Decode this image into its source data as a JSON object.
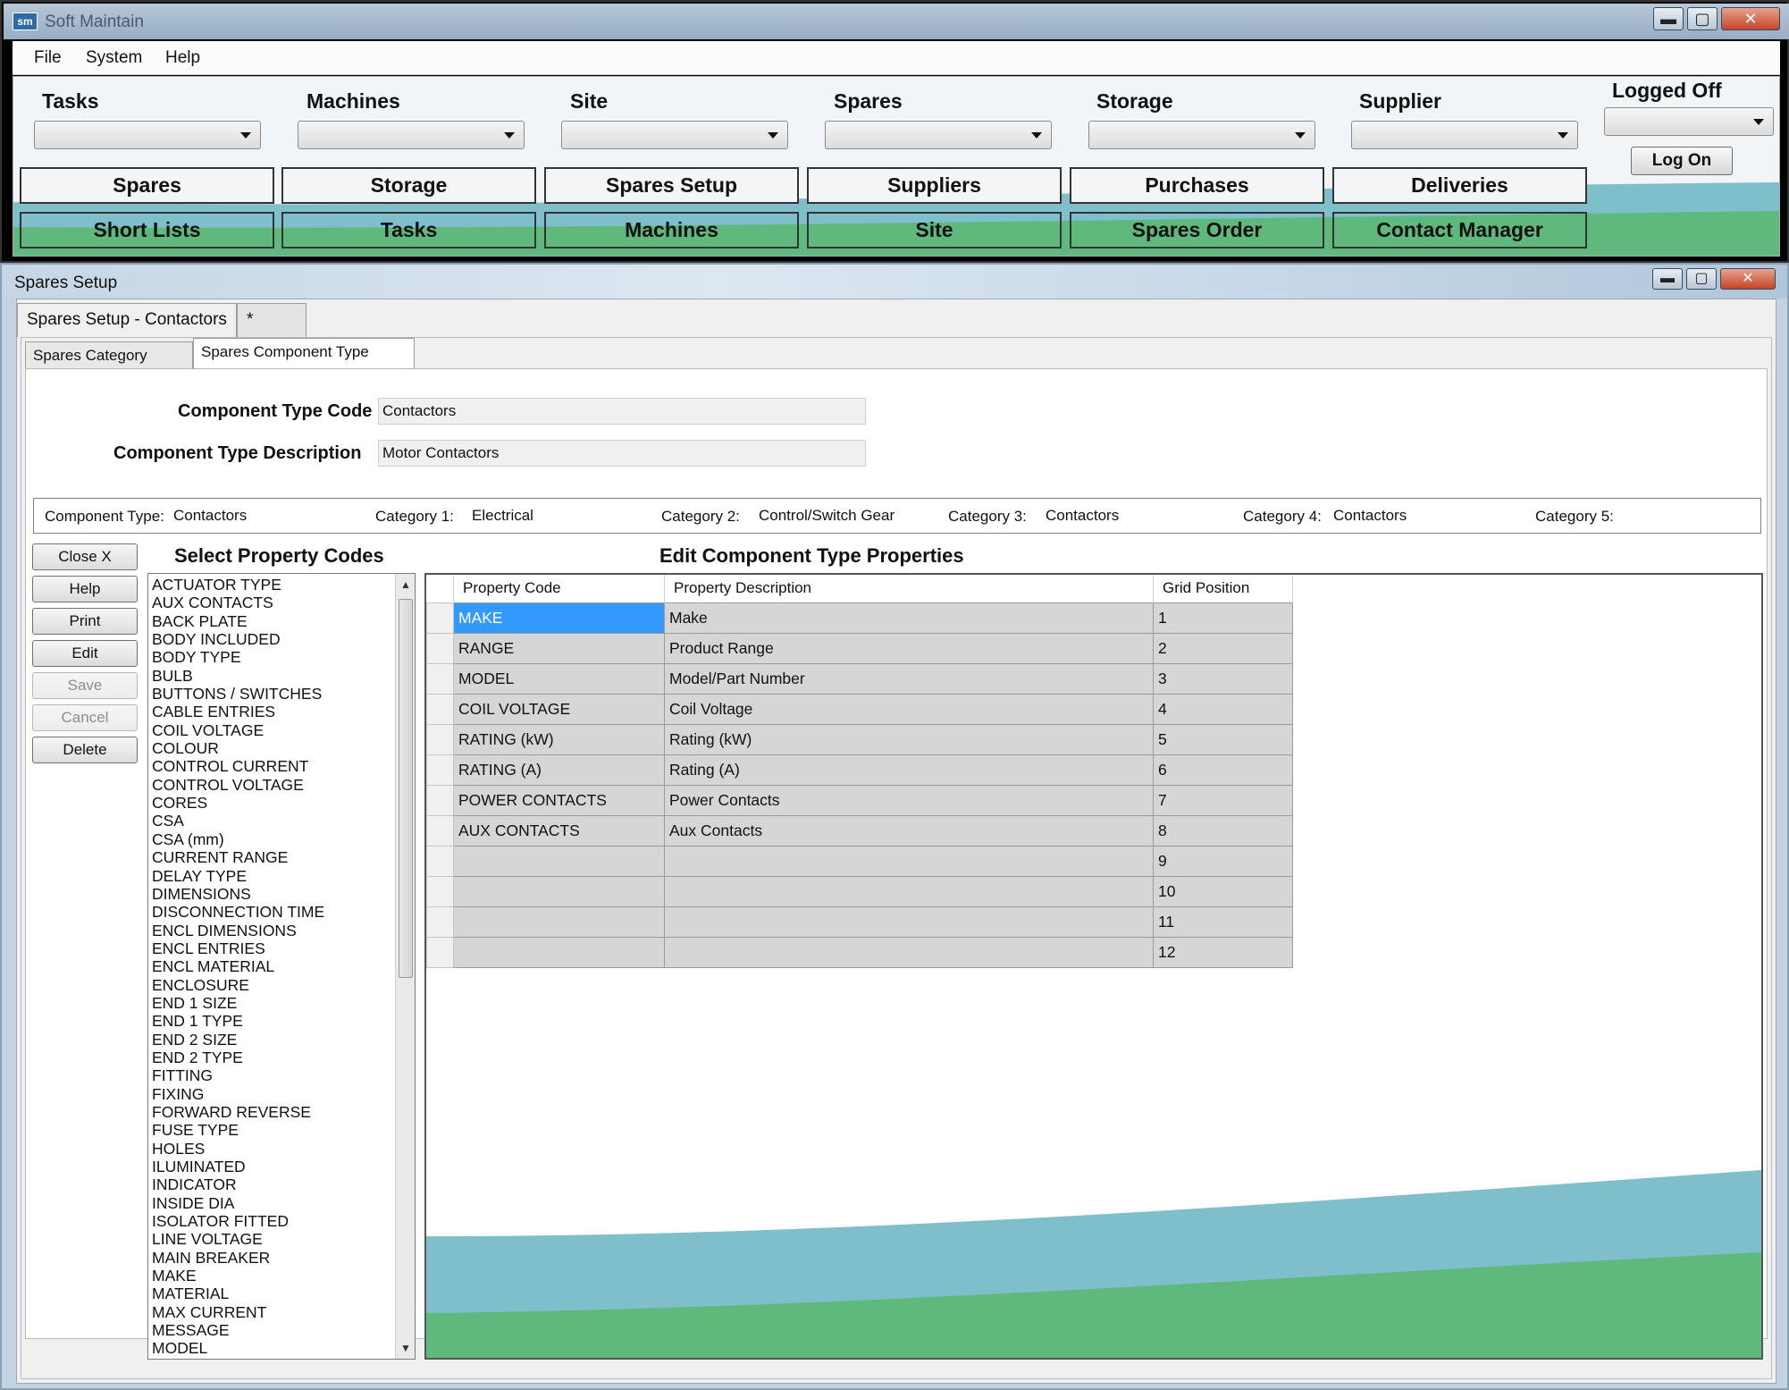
{
  "app": {
    "title": "Soft Maintain",
    "icon_text": "sm"
  },
  "window_controls": {
    "minimize": "▬",
    "maximize": "▢",
    "close": "✕"
  },
  "menu": [
    "File",
    "System",
    "Help"
  ],
  "toolbar": {
    "combos": [
      {
        "label": "Tasks",
        "value": ""
      },
      {
        "label": "Machines",
        "value": ""
      },
      {
        "label": "Site",
        "value": ""
      },
      {
        "label": "Spares",
        "value": ""
      },
      {
        "label": "Storage",
        "value": ""
      },
      {
        "label": "Supplier",
        "value": ""
      }
    ],
    "login_status": "Logged Off",
    "login_combo_value": "",
    "log_on_label": "Log On",
    "row1_buttons": [
      "Spares",
      "Storage",
      "Spares Setup",
      "Suppliers",
      "Purchases",
      "Deliveries"
    ],
    "row2_buttons": [
      "Short Lists",
      "Tasks",
      "Machines",
      "Site",
      "Spares Order",
      "Contact Manager"
    ],
    "colors": {
      "wave_blue": "#7fbfcb",
      "wave_green": "#5fb87c"
    }
  },
  "child": {
    "title": "Spares Setup",
    "doc_tabs": [
      "Spares Setup - Contactors",
      "*"
    ],
    "sub_tabs": [
      "Spares Category Setup",
      "Spares Component Type Setup"
    ],
    "active_sub_tab": 1,
    "fields": {
      "code_label": "Component Type Code",
      "code_value": "Contactors",
      "desc_label": "Component Type Description",
      "desc_value": "Motor Contactors"
    },
    "category_bar": {
      "type_label": "Component Type:",
      "type_value": "Contactors",
      "cat1_label": "Category 1:",
      "cat1_value": "Electrical",
      "cat2_label": "Category 2:",
      "cat2_value": "Control/Switch Gear",
      "cat3_label": "Category 3:",
      "cat3_value": "Contactors",
      "cat4_label": "Category 4:",
      "cat4_value": "Contactors",
      "cat5_label": "Category 5:",
      "cat5_value": ""
    },
    "side_buttons": [
      {
        "label": "Close X",
        "enabled": true
      },
      {
        "label": "Help",
        "enabled": true
      },
      {
        "label": "Print",
        "enabled": true
      },
      {
        "label": "Edit",
        "enabled": true
      },
      {
        "label": "Save",
        "enabled": false
      },
      {
        "label": "Cancel",
        "enabled": false
      },
      {
        "label": "Delete",
        "enabled": true
      }
    ],
    "select_title": "Select Property Codes",
    "edit_title": "Edit Component Type Properties",
    "property_codes": [
      "ACTUATOR TYPE",
      "AUX CONTACTS",
      "BACK PLATE",
      "BODY INCLUDED",
      "BODY TYPE",
      "BULB",
      "BUTTONS / SWITCHES",
      "CABLE ENTRIES",
      "COIL VOLTAGE",
      "COLOUR",
      "CONTROL CURRENT",
      "CONTROL VOLTAGE",
      "CORES",
      "CSA",
      "CSA (mm)",
      "CURRENT RANGE",
      "DELAY TYPE",
      "DIMENSIONS",
      "DISCONNECTION TIME",
      "ENCL DIMENSIONS",
      "ENCL ENTRIES",
      "ENCL MATERIAL",
      "ENCLOSURE",
      "END 1 SIZE",
      "END 1 TYPE",
      "END 2 SIZE",
      "END 2 TYPE",
      "FITTING",
      "FIXING",
      "FORWARD REVERSE",
      "FUSE TYPE",
      "HOLES",
      "ILUMINATED",
      "INDICATOR",
      "INSIDE DIA",
      "ISOLATOR FITTED",
      "LINE VOLTAGE",
      "MAIN BREAKER",
      "MAKE",
      "MATERIAL",
      "MAX CURRENT",
      "MESSAGE",
      "MODEL"
    ],
    "grid": {
      "columns": [
        "Property Code",
        "Property Description",
        "Grid Position"
      ],
      "rows": [
        [
          "MAKE",
          "Make",
          "1"
        ],
        [
          "RANGE",
          "Product Range",
          "2"
        ],
        [
          "MODEL",
          "Model/Part Number",
          "3"
        ],
        [
          "COIL VOLTAGE",
          "Coil Voltage",
          "4"
        ],
        [
          "RATING (kW)",
          "Rating (kW)",
          "5"
        ],
        [
          "RATING (A)",
          "Rating (A)",
          "6"
        ],
        [
          "POWER CONTACTS",
          "Power Contacts",
          "7"
        ],
        [
          "AUX CONTACTS",
          "Aux Contacts",
          "8"
        ],
        [
          "",
          "",
          "9"
        ],
        [
          "",
          "",
          "10"
        ],
        [
          "",
          "",
          "11"
        ],
        [
          "",
          "",
          "12"
        ]
      ],
      "selected_row": 0
    }
  }
}
